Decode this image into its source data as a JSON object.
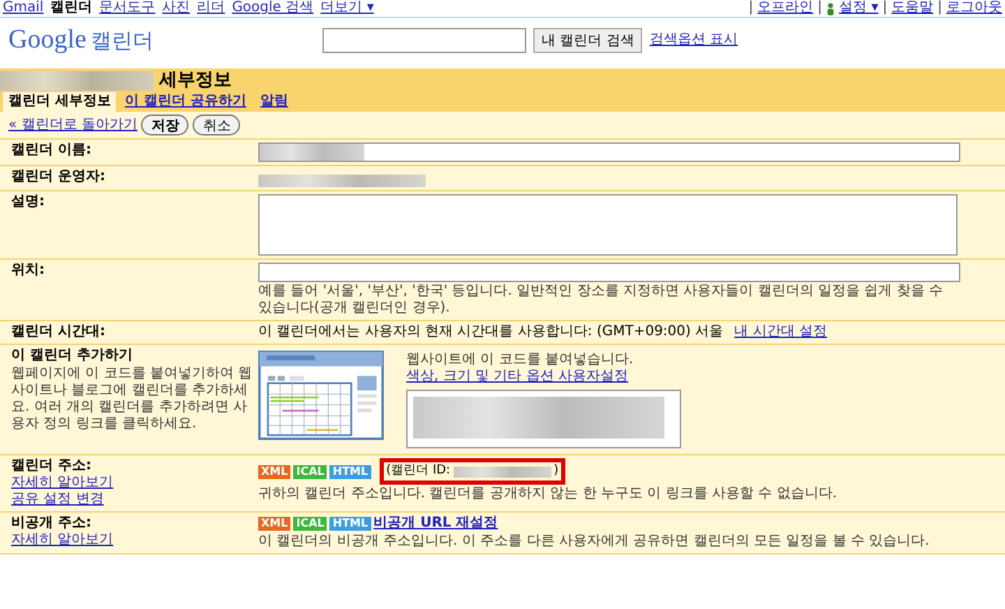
{
  "topnav": {
    "apps": [
      {
        "label": "Gmail",
        "selected": false
      },
      {
        "label": "캘린더",
        "selected": true
      },
      {
        "label": "문서도구",
        "selected": false
      },
      {
        "label": "사진",
        "selected": false
      },
      {
        "label": "리더",
        "selected": false
      },
      {
        "label": "Google 검색",
        "selected": false
      },
      {
        "label": "더보기 ▾",
        "selected": false
      }
    ],
    "separator": "|",
    "right_links": [
      "오프라인",
      "설정 ▾",
      "도움말",
      "로그아웃"
    ]
  },
  "header": {
    "logo_google": "Google",
    "logo_product": "캘린더",
    "search_button": "내 캘린더 검색",
    "search_options": "검색옵션 표시"
  },
  "title": "세부정보",
  "tabs": [
    {
      "label": "캘린더 세부정보",
      "selected": true
    },
    {
      "label": "이 캘린더 공유하기",
      "selected": false
    },
    {
      "label": "알림",
      "selected": false
    }
  ],
  "actions": {
    "back": "« 캘린더로 돌아가기",
    "save": "저장",
    "cancel": "취소"
  },
  "rows": [
    {
      "kind": "input",
      "label": "캘린더 이름:"
    },
    {
      "kind": "owner",
      "label": "캘린더 운영자:"
    },
    {
      "kind": "textarea",
      "label": "설명:"
    },
    {
      "kind": "location",
      "label": "위치:",
      "hint": "예를 들어 '서울', '부산', '한국' 등입니다. 일반적인 장소를 지정하면 사용자들이 캘린더의 일정을 쉽게 찾을 수 있습니다(공개 캘린더인 경우)."
    },
    {
      "kind": "timezone",
      "label": "캘린더 시간대:",
      "text": "이 캘린더에서는 사용자의 현재 시간대를 사용합니다:   (GMT+09:00) 서울",
      "link": "내 시간대 설정"
    },
    {
      "kind": "embed",
      "label": "이 캘린더 추가하기",
      "description": "웹페이지에 이 코드를 붙여넣기하여 웹사이트나 블로그에 캘린더를 추가하세요. 여러 개의 캘린더를 추가하려면 사용자 정의 링크를 클릭하세요.",
      "intro": "웹사이트에 이 코드를 붙여넣습니다.",
      "link": "색상, 크기 및 기타 옵션 사용자설정"
    },
    {
      "kind": "address",
      "label": "캘린더 주소:",
      "links": [
        "자세히 알아보기",
        "공유 설정 변경"
      ],
      "badges": [
        "XML",
        "ICAL",
        "HTML"
      ],
      "id_label": "(캘린더 ID:",
      "id_end": ")",
      "highlighted": true,
      "note": "귀하의 캘린더 주소입니다. 캘린더를 공개하지 않는 한 누구도 이 링크를 사용할 수 없습니다."
    },
    {
      "kind": "private",
      "label": "비공개 주소:",
      "links": [
        "자세히 알아보기"
      ],
      "badges": [
        "XML",
        "ICAL",
        "HTML"
      ],
      "reset": "비공개 URL 재설정",
      "note": "이 캘린더의 비공개 주소입니다. 이 주소를 다른 사용자에게 공유하면 캘린더의 모든 일정을 볼 수 있습니다."
    }
  ]
}
